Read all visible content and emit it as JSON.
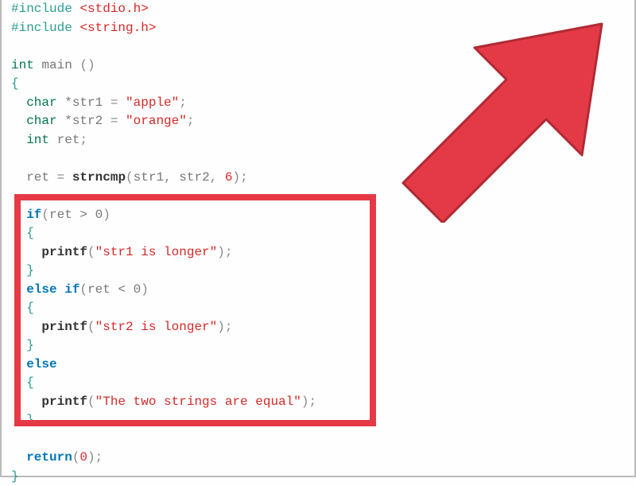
{
  "code": {
    "line1_preproc": "#include",
    "line1_header": "<stdio.h>",
    "line2_preproc": "#include",
    "line2_header": "<string.h>",
    "main_type": "int",
    "main_name": "main",
    "char_kw": "char",
    "int_kw": "int",
    "str1_var": "*str1",
    "str1_val": "\"apple\"",
    "str2_var": "*str2",
    "str2_val": "\"orange\"",
    "ret_var": "ret",
    "strncmp_name": "strncmp",
    "args_str1": "str1",
    "args_str2": "str2",
    "args_num": "6",
    "if_kw": "if",
    "else_kw": "else",
    "cond1": "ret > 0",
    "cond2": "ret < 0",
    "printf_name": "printf",
    "msg1": "\"str1 is longer\"",
    "msg2": "\"str2 is longer\"",
    "msg3": "\"The two strings are equal\"",
    "return_kw": "return",
    "return_val": "0",
    "eq": " = ",
    "semi": ";",
    "open_brace": "{",
    "close_brace": "}",
    "open_paren": "(",
    "close_paren": ")",
    "comma": ", ",
    "space": " "
  }
}
